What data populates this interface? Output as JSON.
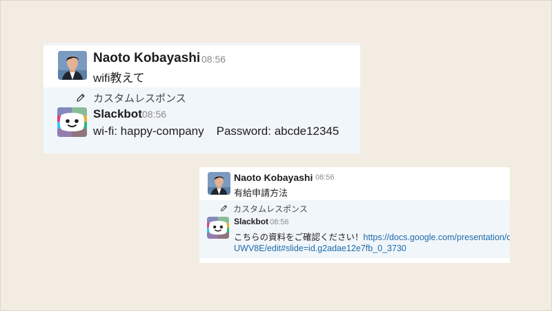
{
  "conversation_1": {
    "user": {
      "name": "Naoto Kobayashi",
      "time": "08:56",
      "message": "wifi教えて"
    },
    "custom_response_label": "カスタムレスポンス",
    "bot": {
      "name": "Slackbot",
      "time": "08:56",
      "wifi_text": "wi-fi: happy-company",
      "password_text": "Password: abcde12345"
    }
  },
  "conversation_2": {
    "user": {
      "name": "Naoto Kobayashi",
      "time": "08:56",
      "message": "有給申請方法"
    },
    "custom_response_label": "カスタムレスポンス",
    "bot": {
      "name": "Slackbot",
      "time": "08:56",
      "message_prefix": "こちらの資料をご確認ください！",
      "link_line1": "https://docs.google.com/presentation/d/",
      "link_line2": "UWV8E/edit#slide=id.g2adae12e7fb_0_3730"
    }
  },
  "colors": {
    "background": "#f2ece3",
    "card": "#ffffff",
    "bot_row": "#f1f6fb",
    "link": "#1d6aa8",
    "slackbot_pink": "#e0407a",
    "slackbot_yellow": "#ecb22e",
    "slackbot_green": "#2eb67d",
    "slackbot_blue": "#36c5f0"
  },
  "icons": [
    "avatar-photo",
    "pencil-icon",
    "slackbot-logo"
  ]
}
